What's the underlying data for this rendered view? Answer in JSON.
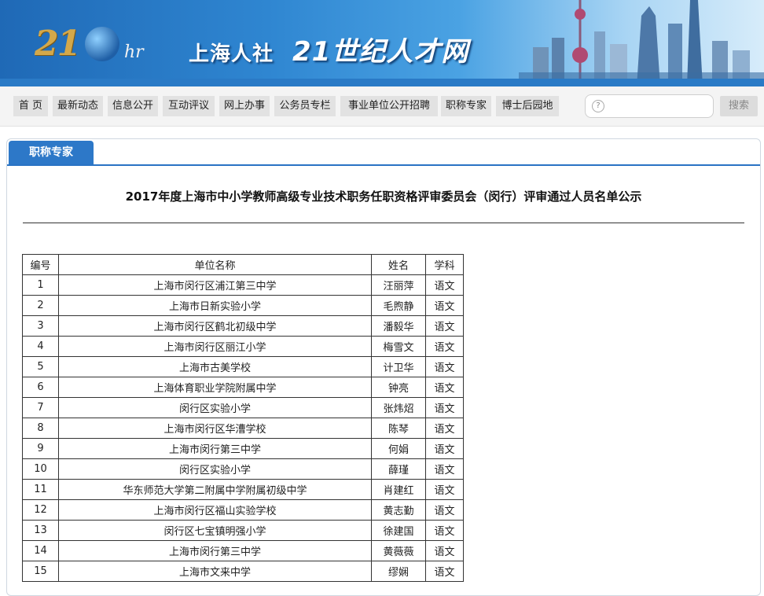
{
  "header": {
    "logo_num": "21",
    "logo_hr": "hr",
    "site_city": "上海人社",
    "site_name": "21世纪人才网"
  },
  "nav": {
    "items": [
      "首 页",
      "最新动态",
      "信息公开",
      "互动评议",
      "网上办事",
      "公务员专栏",
      "事业单位公开招聘",
      "职称专家",
      "博士后园地"
    ]
  },
  "search": {
    "icon": "question-icon",
    "placeholder": "",
    "button_label": "搜索"
  },
  "panel": {
    "tab_label": "职称专家"
  },
  "article": {
    "title": "2017年度上海市中小学教师高级专业技术职务任职资格评审委员会（闵行）评审通过人员名单公示"
  },
  "table": {
    "headers": [
      "编号",
      "单位名称",
      "姓名",
      "学科"
    ],
    "rows": [
      [
        "1",
        "上海市闵行区浦江第三中学",
        "汪丽萍",
        "语文"
      ],
      [
        "2",
        "上海市日新实验小学",
        "毛煦静",
        "语文"
      ],
      [
        "3",
        "上海市闵行区鹤北初级中学",
        "潘毅华",
        "语文"
      ],
      [
        "4",
        "上海市闵行区丽江小学",
        "梅雪文",
        "语文"
      ],
      [
        "5",
        "上海市古美学校",
        "计卫华",
        "语文"
      ],
      [
        "6",
        "上海体育职业学院附属中学",
        "钟亮",
        "语文"
      ],
      [
        "7",
        "闵行区实验小学",
        "张炜炤",
        "语文"
      ],
      [
        "8",
        "上海市闵行区华漕学校",
        "陈琴",
        "语文"
      ],
      [
        "9",
        "上海市闵行第三中学",
        "何娟",
        "语文"
      ],
      [
        "10",
        "闵行区实验小学",
        "薛瑾",
        "语文"
      ],
      [
        "11",
        "华东师范大学第二附属中学附属初级中学",
        "肖建红",
        "语文"
      ],
      [
        "12",
        "上海市闵行区福山实验学校",
        "黄志勤",
        "语文"
      ],
      [
        "13",
        "闵行区七宝镇明强小学",
        "徐建国",
        "语文"
      ],
      [
        "14",
        "上海市闵行第三中学",
        "黄薇薇",
        "语文"
      ],
      [
        "15",
        "上海市文来中学",
        "缪娴",
        "语文"
      ]
    ]
  },
  "colors": {
    "accent": "#2d78c8",
    "banner_start": "#1f69b6",
    "nav_item_bg": "#e2e2e2"
  }
}
